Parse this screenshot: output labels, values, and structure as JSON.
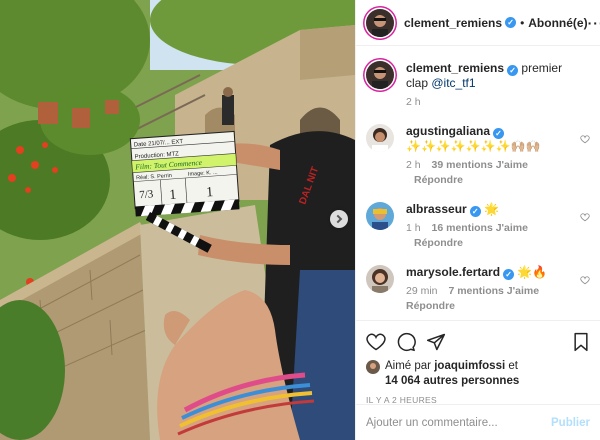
{
  "post": {
    "author": "clement_remiens",
    "follow_state": "Abonné(e)",
    "more_icon": "ellipsis-icon",
    "caption_author": "clement_remiens",
    "caption_text": "premier clap",
    "caption_tag": "@itc_tf1",
    "caption_time": "2 h"
  },
  "clapper": {
    "date": "Date 21/07/... EXT",
    "production": "Production: MTZ",
    "film": "Film: Tout Commence",
    "director": "Réal: S. Perrin",
    "dop": "Image: K. ...",
    "scene": "7/3",
    "take": "1",
    "roll": "1"
  },
  "comments": [
    {
      "user": "agustingaliana",
      "verified": true,
      "text": "✨✨✨✨✨✨✨🙌🏼🙌🏼",
      "time": "2 h",
      "likes": "39 mentions J'aime",
      "reply": "Répondre"
    },
    {
      "user": "albrasseur",
      "verified": true,
      "text": "🌟",
      "time": "1 h",
      "likes": "16 mentions J'aime",
      "reply": "Répondre"
    },
    {
      "user": "marysole.fertard",
      "verified": true,
      "text": "🌟🔥",
      "time": "29 min",
      "likes": "7 mentions J'aime",
      "reply": "Répondre"
    }
  ],
  "likes": {
    "prefix": "Aimé par",
    "user": "joaquimfossi",
    "conj": "et",
    "count": "14 064 autres personnes"
  },
  "timestamp": "IL Y A 2 HEURES",
  "add_comment": {
    "placeholder": "Ajouter un commentaire...",
    "publish_label": "Publier"
  },
  "colors": {
    "verified": "#3897f0",
    "story_ring": "#d6249f",
    "publish_disabled": "#b2dffc",
    "muted": "#8e8e8e"
  }
}
